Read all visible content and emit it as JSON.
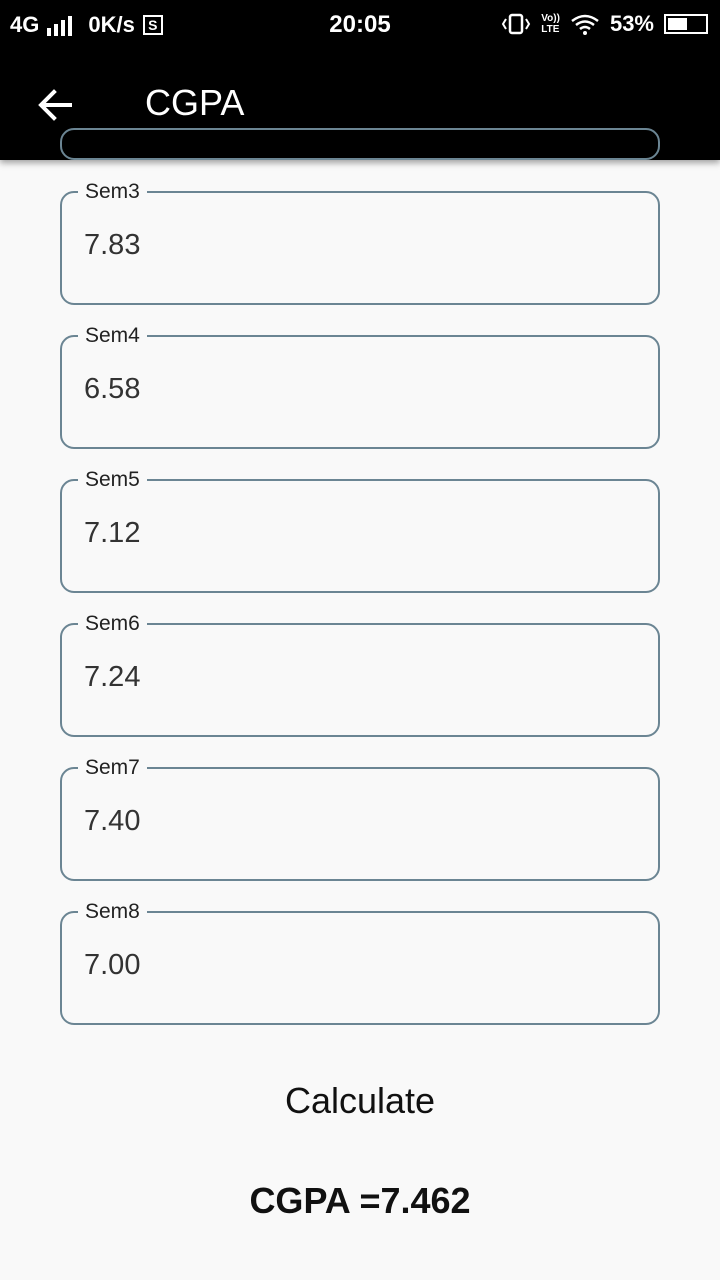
{
  "status_bar": {
    "network": "4G",
    "speed": "0K/s",
    "time": "20:05",
    "lte_top": "Vo))",
    "lte_bottom": "LTE",
    "battery": "53%",
    "battery_level": 0.53
  },
  "app_bar": {
    "title": "CGPA"
  },
  "fields": [
    {
      "label": "Sem3",
      "value": "7.83"
    },
    {
      "label": "Sem4",
      "value": "6.58"
    },
    {
      "label": "Sem5",
      "value": "7.12"
    },
    {
      "label": "Sem6",
      "value": "7.24"
    },
    {
      "label": "Sem7",
      "value": "7.40"
    },
    {
      "label": "Sem8",
      "value": "7.00"
    }
  ],
  "calculate_label": "Calculate",
  "result_text": "CGPA =7.462",
  "colors": {
    "field_border": "#6b8593",
    "background": "#f9f9f9",
    "app_bar": "#000000"
  }
}
